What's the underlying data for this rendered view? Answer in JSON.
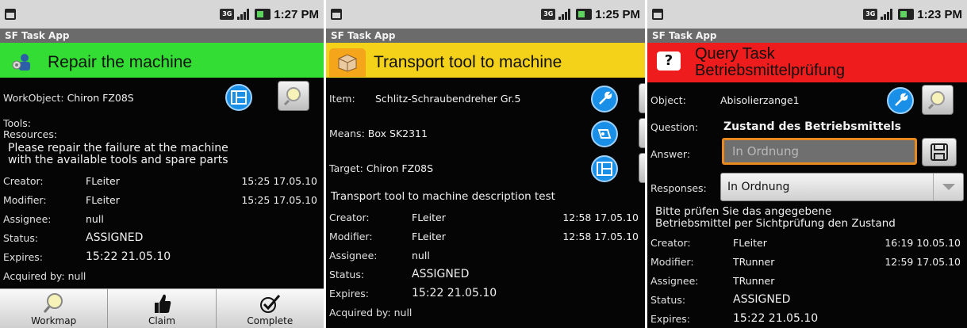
{
  "screens": [
    {
      "clock": "1:27 PM",
      "app_title": "SF Task App",
      "title": "Repair the machine",
      "title_color": "#33dd33",
      "icon": "worker-icon",
      "workobject_label": "WorkObject:",
      "workobject_value": "Chiron FZ08S",
      "tools_label": "Tools:",
      "resources_label": "Resources:",
      "description_line1": "Please repair the failure at the machine",
      "description_line2": "with the available tools and spare parts",
      "creator_label": "Creator:",
      "creator_value": "FLeiter",
      "creator_time": "15:25 17.05.10",
      "modifier_label": "Modifier:",
      "modifier_value": "FLeiter",
      "modifier_time": "15:25 17.05.10",
      "assignee_label": "Assignee:",
      "assignee_value": "null",
      "status_label": "Status:",
      "status_value": "ASSIGNED",
      "expires_label": "Expires:",
      "expires_value": "15:22 21.05.10",
      "acquired_label": "Acquired by: null",
      "buttons": {
        "workmap": "Workmap",
        "claim": "Claim",
        "complete": "Complete"
      }
    },
    {
      "clock": "1:25 PM",
      "app_title": "SF Task App",
      "title": "Transport tool to machine",
      "title_color": "#f4d21a",
      "icon": "package-icon",
      "item_label": "Item:",
      "item_value": "Schlitz-Schraubendreher Gr.5",
      "means_label": "Means:",
      "means_value": "Box SK2311",
      "target_label": "Target:",
      "target_value": "Chiron FZ08S",
      "description": "Transport tool to machine description test",
      "creator_label": "Creator:",
      "creator_value": "FLeiter",
      "creator_time": "12:58 17.05.10",
      "modifier_label": "Modifier:",
      "modifier_value": "FLeiter",
      "modifier_time": "12:58 17.05.10",
      "assignee_label": "Assignee:",
      "assignee_value": "null",
      "status_label": "Status:",
      "status_value": "ASSIGNED",
      "expires_label": "Expires:",
      "expires_value": "15:22 21.05.10",
      "acquired_label": "Acquired by: null"
    },
    {
      "clock": "1:23 PM",
      "app_title": "SF Task App",
      "title_line1": "Query Task",
      "title_line2": "Betriebsmittelprüfung",
      "title_color": "#ee1c1c",
      "icon_glyph": "?",
      "object_label": "Object:",
      "object_value": "Abisolierzange1",
      "question_label": "Question:",
      "question_value": "Zustand des Betriebsmittels",
      "answer_label": "Answer:",
      "answer_placeholder": "In Ordnung",
      "responses_label": "Responses:",
      "responses_value": "In Ordnung",
      "description_line1": "Bitte prüfen Sie das angegebene",
      "description_line2": "Betriebsmittel per Sichtprüfung den Zustand",
      "creator_label": "Creator:",
      "creator_value": "FLeiter",
      "creator_time": "16:19 10.05.10",
      "modifier_label": "Modifier:",
      "modifier_value": "TRunner",
      "modifier_time": "12:59 17.05.10",
      "assignee_label": "Assignee:",
      "assignee_value": "TRunner",
      "status_label": "Status:",
      "status_value": "ASSIGNED",
      "expires_label": "Expires:",
      "expires_value": "15:22 21.05.10"
    }
  ]
}
